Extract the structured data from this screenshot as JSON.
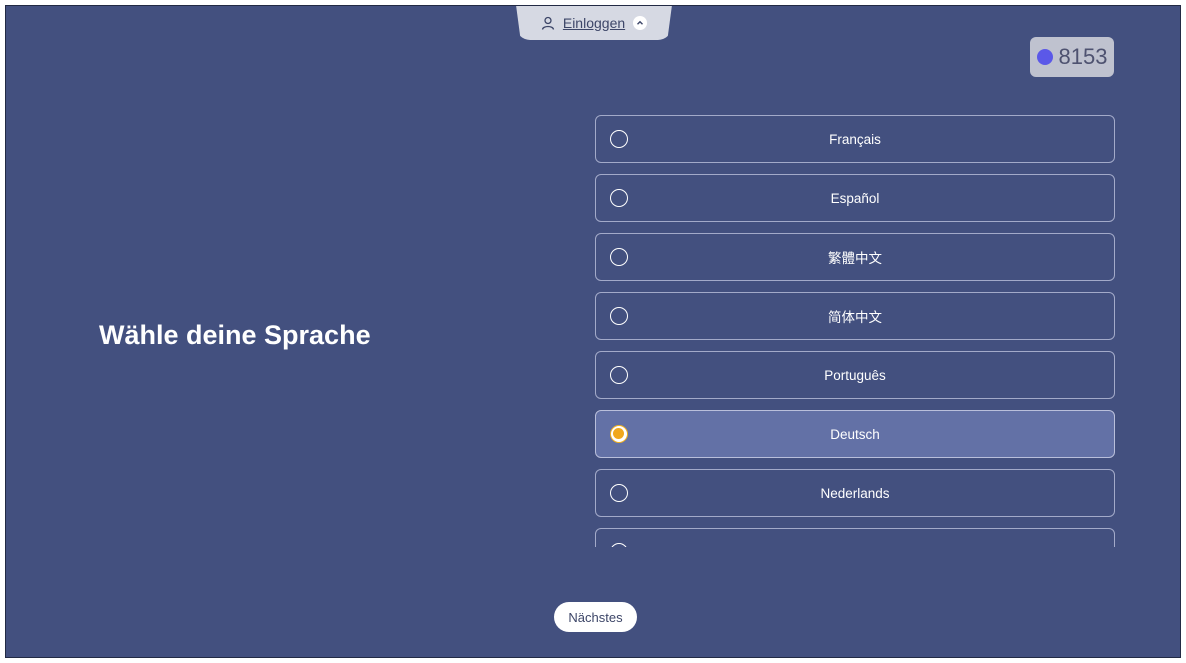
{
  "header": {
    "login_label": "Einloggen",
    "login_icon": "user-icon",
    "toggle_icon": "chevron-up-icon"
  },
  "counter": {
    "value": "8153",
    "dot_color": "#5b58e8"
  },
  "main": {
    "title": "Wähle deine Sprache",
    "languages": [
      {
        "label": "Français",
        "selected": false
      },
      {
        "label": "Español",
        "selected": false
      },
      {
        "label": "繁體中文",
        "selected": false
      },
      {
        "label": "简体中文",
        "selected": false
      },
      {
        "label": "Português",
        "selected": false
      },
      {
        "label": "Deutsch",
        "selected": true
      },
      {
        "label": "Nederlands",
        "selected": false
      },
      {
        "label": "",
        "selected": false
      }
    ]
  },
  "footer": {
    "next_label": "Nächstes"
  },
  "colors": {
    "background": "#43507f",
    "selected_row": "#6371a6",
    "radio_accent": "#f0a71c"
  }
}
